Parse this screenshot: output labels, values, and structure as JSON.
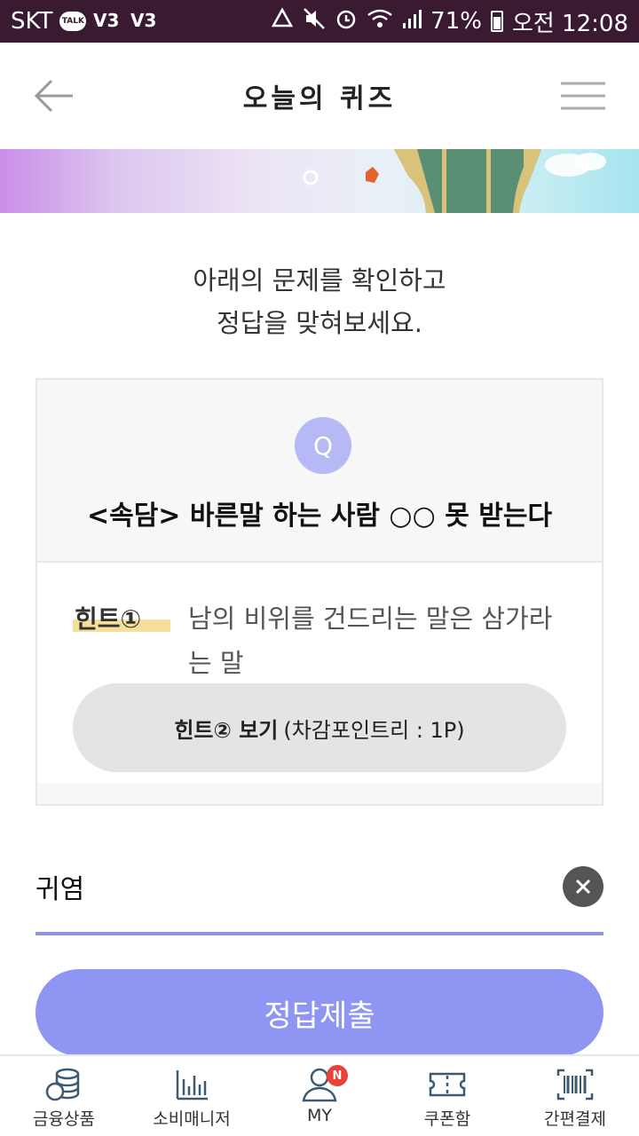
{
  "status_bar": {
    "carrier": "SKT",
    "talk_label": "TALK",
    "battery": "71%",
    "time": "오전 12:08"
  },
  "header": {
    "title": "오늘의 퀴즈"
  },
  "intro": {
    "line1": "아래의 문제를 확인하고",
    "line2": "정답을 맞혀보세요."
  },
  "quiz": {
    "badge": "Q",
    "question": "<속담> 바른말 하는 사람 ○○ 못 받는다",
    "hint1_label": "힌트①",
    "hint1_text": "남의 비위를 건드리는 말은 삼가라는 말",
    "hint2_strong": "힌트② 보기",
    "hint2_cost": "(차감포인트리 : 1P)"
  },
  "answer": {
    "value": "귀염"
  },
  "submit_label": "정답제출",
  "bottom_nav": {
    "items": [
      {
        "label": "금융상품",
        "icon": "coins-icon"
      },
      {
        "label": "소비매니저",
        "icon": "bar-chart-icon"
      },
      {
        "label": "MY",
        "icon": "user-icon",
        "badge": "N"
      },
      {
        "label": "쿠폰함",
        "icon": "coupon-icon"
      },
      {
        "label": "간편결제",
        "icon": "barcode-icon"
      }
    ]
  },
  "colors": {
    "accent": "#8e95f2",
    "status_bar": "#3a1a31",
    "badge_red": "#e8423a",
    "highlight": "#f5d98a"
  }
}
